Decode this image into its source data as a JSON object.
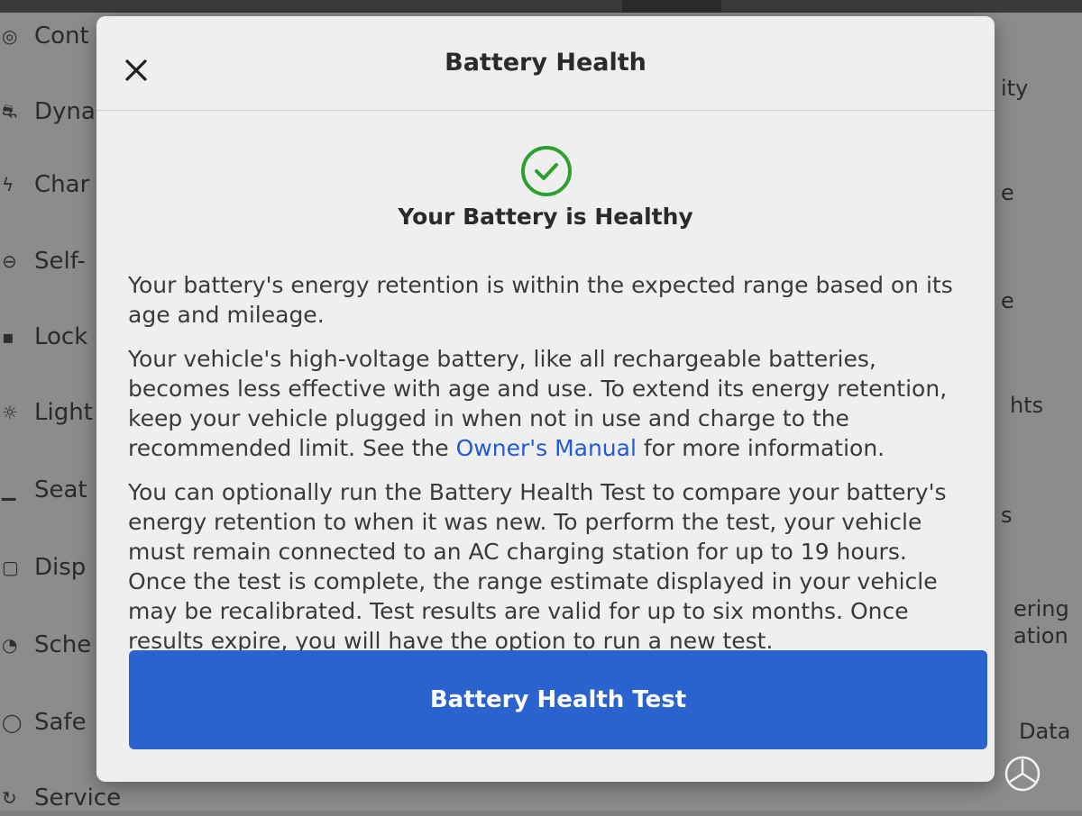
{
  "background": {
    "sidebar_items": [
      {
        "icon": "controls-icon",
        "label": "Cont"
      },
      {
        "icon": "dynamics-icon",
        "label": "Dyna"
      },
      {
        "icon": "charging-icon",
        "label": "Char"
      },
      {
        "icon": "self-driving-icon",
        "label": "Self-"
      },
      {
        "icon": "lock-icon",
        "label": "Lock"
      },
      {
        "icon": "lights-icon",
        "label": "Light"
      },
      {
        "icon": "seat-icon",
        "label": "Seat"
      },
      {
        "icon": "display-icon",
        "label": "Disp"
      },
      {
        "icon": "schedule-icon",
        "label": "Sche"
      },
      {
        "icon": "safety-icon",
        "label": "Safe"
      },
      {
        "icon": "service-icon",
        "label": "Service"
      }
    ],
    "right_fragments": [
      "ity",
      "e",
      "e",
      "hts",
      "s",
      "ering",
      "ation",
      "Data"
    ]
  },
  "modal": {
    "title": "Battery Health",
    "close_icon": "close-icon",
    "status_icon": "check-circle-icon",
    "status_color": "#2aa12e",
    "status_heading": "Your Battery is Healthy",
    "paragraph_1": "Your battery's energy retention is within the expected range based on its age and mileage.",
    "paragraph_2_before_link": "Your vehicle's high-voltage battery, like all rechargeable batteries, becomes less effective with age and use. To extend its energy retention, keep your vehicle plugged in when not in use and charge to the recommended limit. See the ",
    "paragraph_2_link": "Owner's Manual",
    "paragraph_2_after_link": " for more information.",
    "paragraph_3": "You can optionally run the Battery Health Test to compare your battery's energy retention to when it was new. To perform the test, your vehicle must remain connected to an AC charging station for up to 19 hours. Once the test is complete, the range estimate displayed in your vehicle may be recalibrated. Test results are valid for up to six months. Once results expire, you will have the option to run a new test.",
    "primary_button_label": "Battery Health Test",
    "accent_color": "#2a62cf",
    "link_color": "#1f5bd8"
  }
}
